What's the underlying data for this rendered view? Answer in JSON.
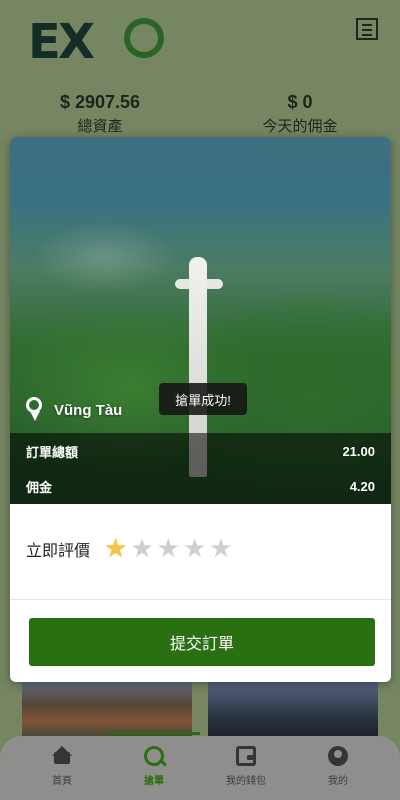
{
  "header": {
    "brand": "EXO",
    "stats": {
      "total_assets_value": "$ 2907.56",
      "total_assets_label": "總資產",
      "today_commission_value": "$ 0",
      "today_commission_label": "今天的佣金"
    }
  },
  "modal": {
    "location": "Vũng Tàu",
    "toast": "搶單成功!",
    "amounts": [
      {
        "label": "訂單總額",
        "value": "21.00"
      },
      {
        "label": "佣金",
        "value": "4.20"
      }
    ],
    "rating_label": "立即評價",
    "stars_total": 5,
    "stars_selected": 1,
    "submit_label": "提交訂單"
  },
  "bottom_nav": {
    "items": [
      {
        "label": "首頁",
        "icon": "home-icon"
      },
      {
        "label": "搶單",
        "icon": "grab-order-icon"
      },
      {
        "label": "我的錢包",
        "icon": "wallet-icon"
      },
      {
        "label": "我的",
        "icon": "user-icon"
      }
    ],
    "active_index": 1
  },
  "colors": {
    "accent": "#2a6f12",
    "background": "#7e8f6a",
    "nav": "#8e8f8d"
  }
}
